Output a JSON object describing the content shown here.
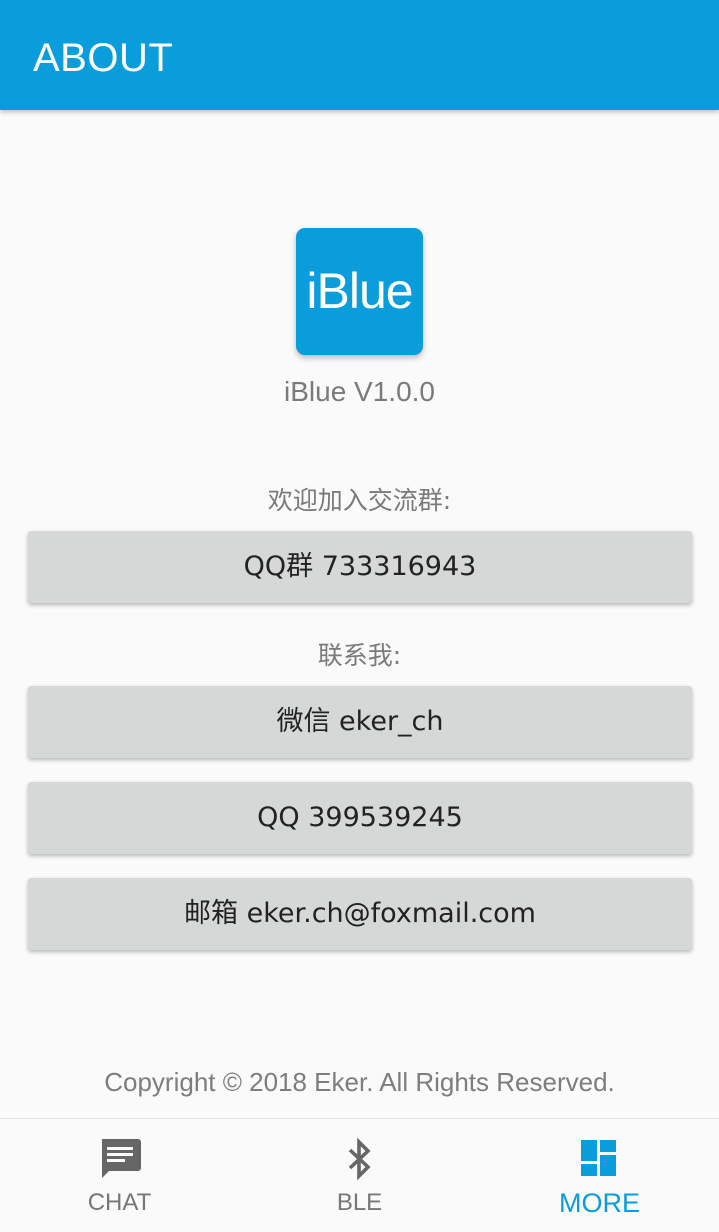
{
  "app_bar": {
    "title": "ABOUT"
  },
  "app_info": {
    "logo_text": "iBlue",
    "version": "iBlue V1.0.0"
  },
  "group_section": {
    "label": "欢迎加入交流群:",
    "buttons": [
      {
        "text": "QQ群 733316943"
      }
    ]
  },
  "contact_section": {
    "label": "联系我:",
    "buttons": [
      {
        "text": "微信 eker_ch"
      },
      {
        "text": "QQ 399539245"
      },
      {
        "text": "邮箱 eker.ch@foxmail.com"
      }
    ]
  },
  "footer": {
    "copyright": "Copyright © 2018 Eker. All Rights Reserved."
  },
  "bottom_nav": {
    "items": [
      {
        "label": "CHAT",
        "icon": "chat-icon",
        "active": false
      },
      {
        "label": "BLE",
        "icon": "bluetooth-icon",
        "active": false
      },
      {
        "label": "MORE",
        "icon": "dashboard-icon",
        "active": true
      }
    ]
  },
  "colors": {
    "primary": "#0a9ddb",
    "button_bg": "#d6d7d7",
    "inactive_icon": "#666666",
    "text_gray": "#7a7a7a"
  }
}
